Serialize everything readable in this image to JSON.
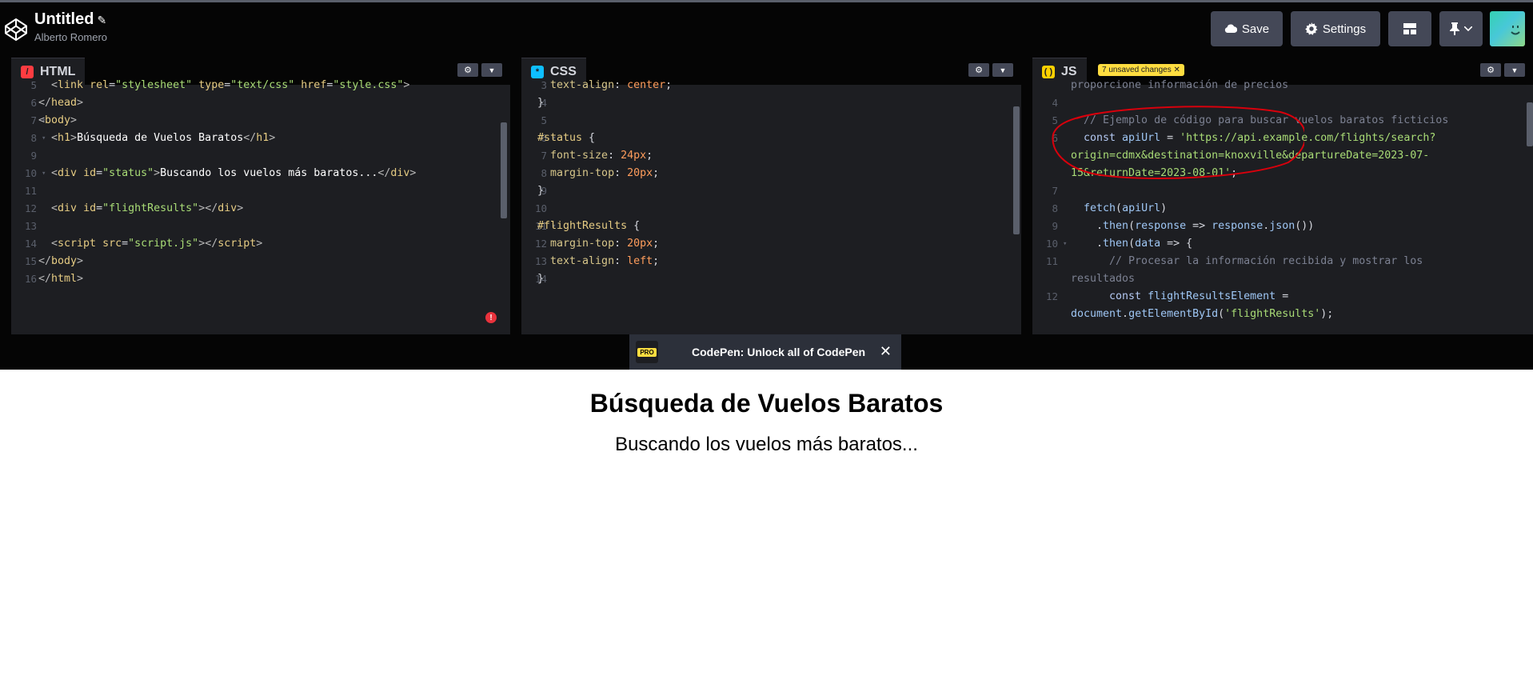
{
  "header": {
    "title": "Untitled",
    "author": "Alberto Romero",
    "save_label": "Save",
    "settings_label": "Settings",
    "icons": [
      "codepen-logo-icon",
      "pencil-icon",
      "cloud-icon",
      "gear-icon",
      "layout-icon",
      "pin-icon",
      "chevron-down-icon"
    ]
  },
  "html_pane": {
    "tab": "HTML",
    "lines": [
      {
        "n": "5",
        "parts": [
          [
            "t-punc",
            "  "
          ],
          [
            "t-tag",
            "<"
          ],
          [
            "t-tagname",
            "link "
          ],
          [
            "t-attr",
            "rel"
          ],
          [
            "t-punc",
            "="
          ],
          [
            "t-str",
            "\"stylesheet\" "
          ],
          [
            "t-attr",
            "type"
          ],
          [
            "t-punc",
            "="
          ],
          [
            "t-str",
            "\"text/css\" "
          ],
          [
            "t-attr",
            "href"
          ],
          [
            "t-punc",
            "="
          ],
          [
            "t-str",
            "\"style.css\""
          ],
          [
            "t-tag",
            ">"
          ]
        ]
      },
      {
        "n": "6",
        "parts": [
          [
            "t-tag",
            "</"
          ],
          [
            "t-tagname",
            "head"
          ],
          [
            "t-tag",
            ">"
          ]
        ]
      },
      {
        "n": "7",
        "fold": true,
        "parts": [
          [
            "t-tag",
            "<"
          ],
          [
            "t-tagname",
            "body"
          ],
          [
            "t-tag",
            ">"
          ]
        ]
      },
      {
        "n": "8",
        "fold": true,
        "parts": [
          [
            "t-punc",
            "  "
          ],
          [
            "t-tag",
            "<"
          ],
          [
            "t-tagname",
            "h1"
          ],
          [
            "t-tag",
            ">"
          ],
          [
            "t-txt",
            "Búsqueda de Vuelos Baratos"
          ],
          [
            "t-tag",
            "</"
          ],
          [
            "t-tagname",
            "h1"
          ],
          [
            "t-tag",
            ">"
          ]
        ]
      },
      {
        "n": "9",
        "parts": []
      },
      {
        "n": "10",
        "fold": true,
        "parts": [
          [
            "t-punc",
            "  "
          ],
          [
            "t-tag",
            "<"
          ],
          [
            "t-tagname",
            "div "
          ],
          [
            "t-attr",
            "id"
          ],
          [
            "t-punc",
            "="
          ],
          [
            "t-str",
            "\"status\""
          ],
          [
            "t-tag",
            ">"
          ],
          [
            "t-txt",
            "Buscando los vuelos más baratos..."
          ],
          [
            "t-tag",
            "</"
          ],
          [
            "t-tagname",
            "div"
          ],
          [
            "t-tag",
            ">"
          ]
        ]
      },
      {
        "n": "11",
        "parts": []
      },
      {
        "n": "12",
        "parts": [
          [
            "t-punc",
            "  "
          ],
          [
            "t-tag",
            "<"
          ],
          [
            "t-tagname",
            "div "
          ],
          [
            "t-attr",
            "id"
          ],
          [
            "t-punc",
            "="
          ],
          [
            "t-str",
            "\"flightResults\""
          ],
          [
            "t-tag",
            "></"
          ],
          [
            "t-tagname",
            "div"
          ],
          [
            "t-tag",
            ">"
          ]
        ]
      },
      {
        "n": "13",
        "parts": []
      },
      {
        "n": "14",
        "parts": [
          [
            "t-punc",
            "  "
          ],
          [
            "t-tag",
            "<"
          ],
          [
            "t-tagname",
            "script "
          ],
          [
            "t-attr",
            "src"
          ],
          [
            "t-punc",
            "="
          ],
          [
            "t-str",
            "\"script.js\""
          ],
          [
            "t-tag",
            "></"
          ],
          [
            "t-tagname",
            "script"
          ],
          [
            "t-tag",
            ">"
          ]
        ]
      },
      {
        "n": "15",
        "parts": [
          [
            "t-tag",
            "</"
          ],
          [
            "t-tagname",
            "body"
          ],
          [
            "t-tag",
            ">"
          ]
        ]
      },
      {
        "n": "16",
        "parts": [
          [
            "t-tag",
            "</"
          ],
          [
            "t-tagname",
            "html"
          ],
          [
            "t-tag",
            ">"
          ]
        ]
      }
    ]
  },
  "css_pane": {
    "tab": "CSS",
    "lines": [
      {
        "n": "3",
        "parts": [
          [
            "t-punc",
            "  "
          ],
          [
            "t-prop",
            "text-align"
          ],
          [
            "t-punc",
            ": "
          ],
          [
            "t-val",
            "center"
          ],
          [
            "t-punc",
            ";"
          ]
        ]
      },
      {
        "n": "4",
        "parts": [
          [
            "t-punc",
            "}"
          ]
        ]
      },
      {
        "n": "5",
        "parts": []
      },
      {
        "n": "6",
        "fold": true,
        "parts": [
          [
            "t-sel",
            "#status "
          ],
          [
            "t-punc",
            "{"
          ]
        ]
      },
      {
        "n": "7",
        "parts": [
          [
            "t-punc",
            "  "
          ],
          [
            "t-prop",
            "font-size"
          ],
          [
            "t-punc",
            ": "
          ],
          [
            "t-val",
            "24px"
          ],
          [
            "t-punc",
            ";"
          ]
        ]
      },
      {
        "n": "8",
        "parts": [
          [
            "t-punc",
            "  "
          ],
          [
            "t-prop",
            "margin-top"
          ],
          [
            "t-punc",
            ": "
          ],
          [
            "t-val",
            "20px"
          ],
          [
            "t-punc",
            ";"
          ]
        ]
      },
      {
        "n": "9",
        "parts": [
          [
            "t-punc",
            "}"
          ]
        ]
      },
      {
        "n": "10",
        "parts": []
      },
      {
        "n": "11",
        "fold": true,
        "parts": [
          [
            "t-sel",
            "#flightResults "
          ],
          [
            "t-punc",
            "{"
          ]
        ]
      },
      {
        "n": "12",
        "parts": [
          [
            "t-punc",
            "  "
          ],
          [
            "t-prop",
            "margin-top"
          ],
          [
            "t-punc",
            ": "
          ],
          [
            "t-val",
            "20px"
          ],
          [
            "t-punc",
            ";"
          ]
        ]
      },
      {
        "n": "13",
        "parts": [
          [
            "t-punc",
            "  "
          ],
          [
            "t-prop",
            "text-align"
          ],
          [
            "t-punc",
            ": "
          ],
          [
            "t-val",
            "left"
          ],
          [
            "t-punc",
            ";"
          ]
        ]
      },
      {
        "n": "14",
        "parts": [
          [
            "t-punc",
            "}"
          ]
        ]
      }
    ]
  },
  "js_pane": {
    "tab": "JS",
    "unsaved_badge": "7 unsaved changes ✕",
    "lines": [
      {
        "n": "",
        "parts": [
          [
            "t-com",
            "proporcione información de precios"
          ]
        ]
      },
      {
        "n": "4",
        "parts": []
      },
      {
        "n": "5",
        "parts": [
          [
            "t-com",
            "  // Ejemplo de código para buscar vuelos baratos ficticios"
          ]
        ]
      },
      {
        "n": "6",
        "parts": [
          [
            "t-kw",
            "  const "
          ],
          [
            "t-id",
            "apiUrl"
          ],
          [
            "t-punc",
            " = "
          ],
          [
            "t-str",
            "'https://api.example.com/flights/search?"
          ]
        ]
      },
      {
        "n": "",
        "parts": [
          [
            "t-str",
            "origin=cdmx&destination=knoxville&departureDate=2023-07-"
          ]
        ]
      },
      {
        "n": "",
        "parts": [
          [
            "t-str",
            "15&returnDate=2023-08-01'"
          ],
          [
            "t-punc",
            ";"
          ]
        ]
      },
      {
        "n": "7",
        "parts": []
      },
      {
        "n": "8",
        "parts": [
          [
            "t-punc",
            "  "
          ],
          [
            "t-id",
            "fetch"
          ],
          [
            "t-punc",
            "("
          ],
          [
            "t-id",
            "apiUrl"
          ],
          [
            "t-punc",
            ")"
          ]
        ]
      },
      {
        "n": "9",
        "parts": [
          [
            "t-punc",
            "    ."
          ],
          [
            "t-id",
            "then"
          ],
          [
            "t-punc",
            "("
          ],
          [
            "t-id",
            "response"
          ],
          [
            "t-punc",
            " => "
          ],
          [
            "t-id",
            "response"
          ],
          [
            "t-punc",
            "."
          ],
          [
            "t-id",
            "json"
          ],
          [
            "t-punc",
            "())"
          ]
        ]
      },
      {
        "n": "10",
        "fold": true,
        "parts": [
          [
            "t-punc",
            "    ."
          ],
          [
            "t-id",
            "then"
          ],
          [
            "t-punc",
            "("
          ],
          [
            "t-id",
            "data"
          ],
          [
            "t-punc",
            " => {"
          ]
        ]
      },
      {
        "n": "11",
        "parts": [
          [
            "t-com",
            "      // Procesar la información recibida y mostrar los"
          ]
        ]
      },
      {
        "n": "",
        "parts": [
          [
            "t-com",
            "resultados"
          ]
        ]
      },
      {
        "n": "12",
        "parts": [
          [
            "t-kw",
            "      const "
          ],
          [
            "t-id",
            "flightResultsElement"
          ],
          [
            "t-punc",
            " ="
          ]
        ]
      },
      {
        "n": "",
        "parts": [
          [
            "t-id",
            "document"
          ],
          [
            "t-punc",
            "."
          ],
          [
            "t-id",
            "getElementById"
          ],
          [
            "t-punc",
            "("
          ],
          [
            "t-str",
            "'flightResults'"
          ],
          [
            "t-punc",
            ");"
          ]
        ]
      }
    ]
  },
  "promo": {
    "badge": "PRO",
    "text": "CodePen: Unlock all of CodePen",
    "close": "✕"
  },
  "preview": {
    "heading": "Búsqueda de Vuelos Baratos",
    "status": "Buscando los vuelos más baratos..."
  },
  "colors": {
    "html_icon": "#ff3c41",
    "css_icon": "#0ebeff",
    "js_icon": "#fcd000",
    "annotation": "#d8000c"
  }
}
